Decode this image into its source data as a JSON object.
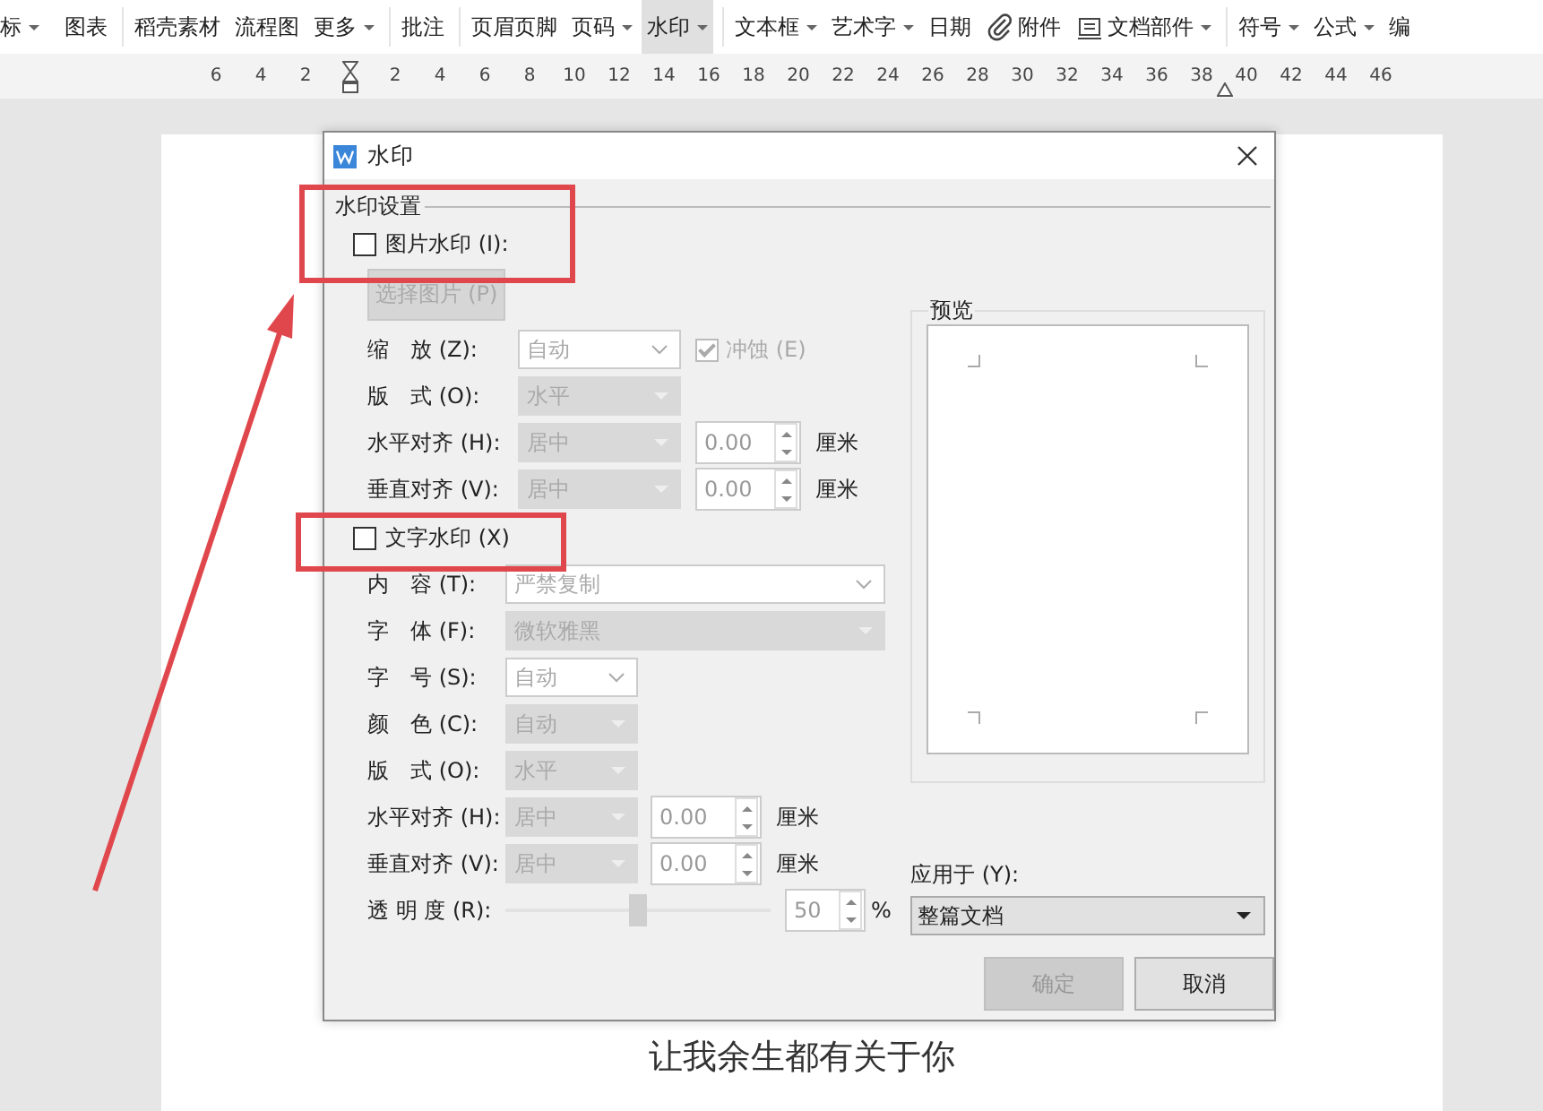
{
  "toolbar": {
    "items": [
      {
        "kind": "text",
        "label": "标",
        "dropdown": true,
        "selected": false
      },
      {
        "kind": "text",
        "label": "图表",
        "dropdown": false,
        "selected": false
      },
      {
        "kind": "separator"
      },
      {
        "kind": "text",
        "label": "稻壳素材",
        "dropdown": false,
        "selected": false
      },
      {
        "kind": "text",
        "label": "流程图",
        "dropdown": false,
        "selected": false
      },
      {
        "kind": "text",
        "label": "更多",
        "dropdown": true,
        "selected": false
      },
      {
        "kind": "separator"
      },
      {
        "kind": "text",
        "label": "批注",
        "dropdown": false,
        "selected": false
      },
      {
        "kind": "separator"
      },
      {
        "kind": "text",
        "label": "页眉页脚",
        "dropdown": false,
        "selected": false
      },
      {
        "kind": "text",
        "label": "页码",
        "dropdown": true,
        "selected": false
      },
      {
        "kind": "text",
        "label": "水印",
        "dropdown": true,
        "selected": true
      },
      {
        "kind": "separator"
      },
      {
        "kind": "text",
        "label": "文本框",
        "dropdown": true,
        "selected": false
      },
      {
        "kind": "text",
        "label": "艺术字",
        "dropdown": true,
        "selected": false
      },
      {
        "kind": "text",
        "label": "日期",
        "dropdown": false,
        "selected": false
      },
      {
        "kind": "attachment",
        "label": "附件",
        "dropdown": false,
        "selected": false
      },
      {
        "kind": "parts",
        "label": "文档部件",
        "dropdown": true,
        "selected": false
      },
      {
        "kind": "separator"
      },
      {
        "kind": "text",
        "label": "符号",
        "dropdown": true,
        "selected": false
      },
      {
        "kind": "text",
        "label": "公式",
        "dropdown": true,
        "selected": false
      },
      {
        "kind": "text",
        "label": "编",
        "dropdown": false,
        "selected": false
      }
    ]
  },
  "ruler": {
    "ticks": [
      {
        "kind": "number",
        "label": "6"
      },
      {
        "kind": "number",
        "label": "4"
      },
      {
        "kind": "number",
        "label": "2"
      },
      {
        "kind": "indent"
      },
      {
        "kind": "number",
        "label": "2"
      },
      {
        "kind": "number",
        "label": "4"
      },
      {
        "kind": "number",
        "label": "6"
      },
      {
        "kind": "number",
        "label": "8"
      },
      {
        "kind": "number",
        "label": "10"
      },
      {
        "kind": "number",
        "label": "12"
      },
      {
        "kind": "number",
        "label": "14"
      },
      {
        "kind": "number",
        "label": "16"
      },
      {
        "kind": "number",
        "label": "18"
      },
      {
        "kind": "number",
        "label": "20"
      },
      {
        "kind": "number",
        "label": "22"
      },
      {
        "kind": "number",
        "label": "24"
      },
      {
        "kind": "number",
        "label": "26"
      },
      {
        "kind": "number",
        "label": "28"
      },
      {
        "kind": "number",
        "label": "30"
      },
      {
        "kind": "number",
        "label": "32"
      },
      {
        "kind": "number",
        "label": "34"
      },
      {
        "kind": "number",
        "label": "36"
      },
      {
        "kind": "number",
        "label": "38"
      },
      {
        "kind": "indent_number",
        "label": "40"
      },
      {
        "kind": "number",
        "label": "42"
      },
      {
        "kind": "number",
        "label": "44"
      },
      {
        "kind": "number",
        "label": "46"
      }
    ]
  },
  "document": {
    "text": "让我余生都有关于你"
  },
  "dialog": {
    "title": "水印",
    "group_label": "水印设置",
    "picture_watermark": {
      "label": "图片水印 (I):",
      "checked": false,
      "select_button": "选择图片 (P)",
      "rows": [
        {
          "label": "缩　放 (Z):",
          "control": {
            "kind": "combo",
            "value": "自动"
          },
          "option": {
            "label": "冲蚀 (E)",
            "checked": true
          }
        },
        {
          "label": "版　式 (O):",
          "control": {
            "kind": "dropdown",
            "value": "水平"
          }
        },
        {
          "label": "水平对齐 (H):",
          "control": {
            "kind": "dropdown",
            "value": "居中"
          },
          "spin": {
            "value": "0.00",
            "unit": "厘米"
          }
        },
        {
          "label": "垂直对齐 (V):",
          "control": {
            "kind": "dropdown",
            "value": "居中"
          },
          "spin": {
            "value": "0.00",
            "unit": "厘米"
          }
        }
      ]
    },
    "text_watermark": {
      "label": "文字水印 (X)",
      "checked": false,
      "rows": [
        {
          "label": "内　容 (T):",
          "control": {
            "kind": "combo",
            "value": "严禁复制"
          }
        },
        {
          "label": "字　体 (F):",
          "control": {
            "kind": "dropdown",
            "value": "微软雅黑"
          }
        },
        {
          "label": "字　号 (S):",
          "control": {
            "kind": "combo",
            "value": "自动"
          }
        },
        {
          "label": "颜　色 (C):",
          "control": {
            "kind": "dropdown",
            "value": "自动"
          }
        },
        {
          "label": "版　式 (O):",
          "control": {
            "kind": "dropdown",
            "value": "水平"
          }
        },
        {
          "label": "水平对齐 (H):",
          "control": {
            "kind": "dropdown",
            "value": "居中"
          },
          "spin": {
            "value": "0.00",
            "unit": "厘米"
          }
        },
        {
          "label": "垂直对齐 (V):",
          "control": {
            "kind": "dropdown",
            "value": "居中"
          },
          "spin": {
            "value": "0.00",
            "unit": "厘米"
          }
        },
        {
          "label": "透 明 度 (R):",
          "control": {
            "kind": "slider",
            "level": 0.5
          },
          "spin": {
            "value": "50",
            "unit": "%"
          }
        }
      ]
    },
    "preview": {
      "label": "预览"
    },
    "apply_to": {
      "label": "应用于 (Y):",
      "value": "整篇文档"
    },
    "buttons": [
      {
        "label": "确定",
        "disabled": true
      },
      {
        "label": "取消",
        "disabled": false
      }
    ]
  }
}
